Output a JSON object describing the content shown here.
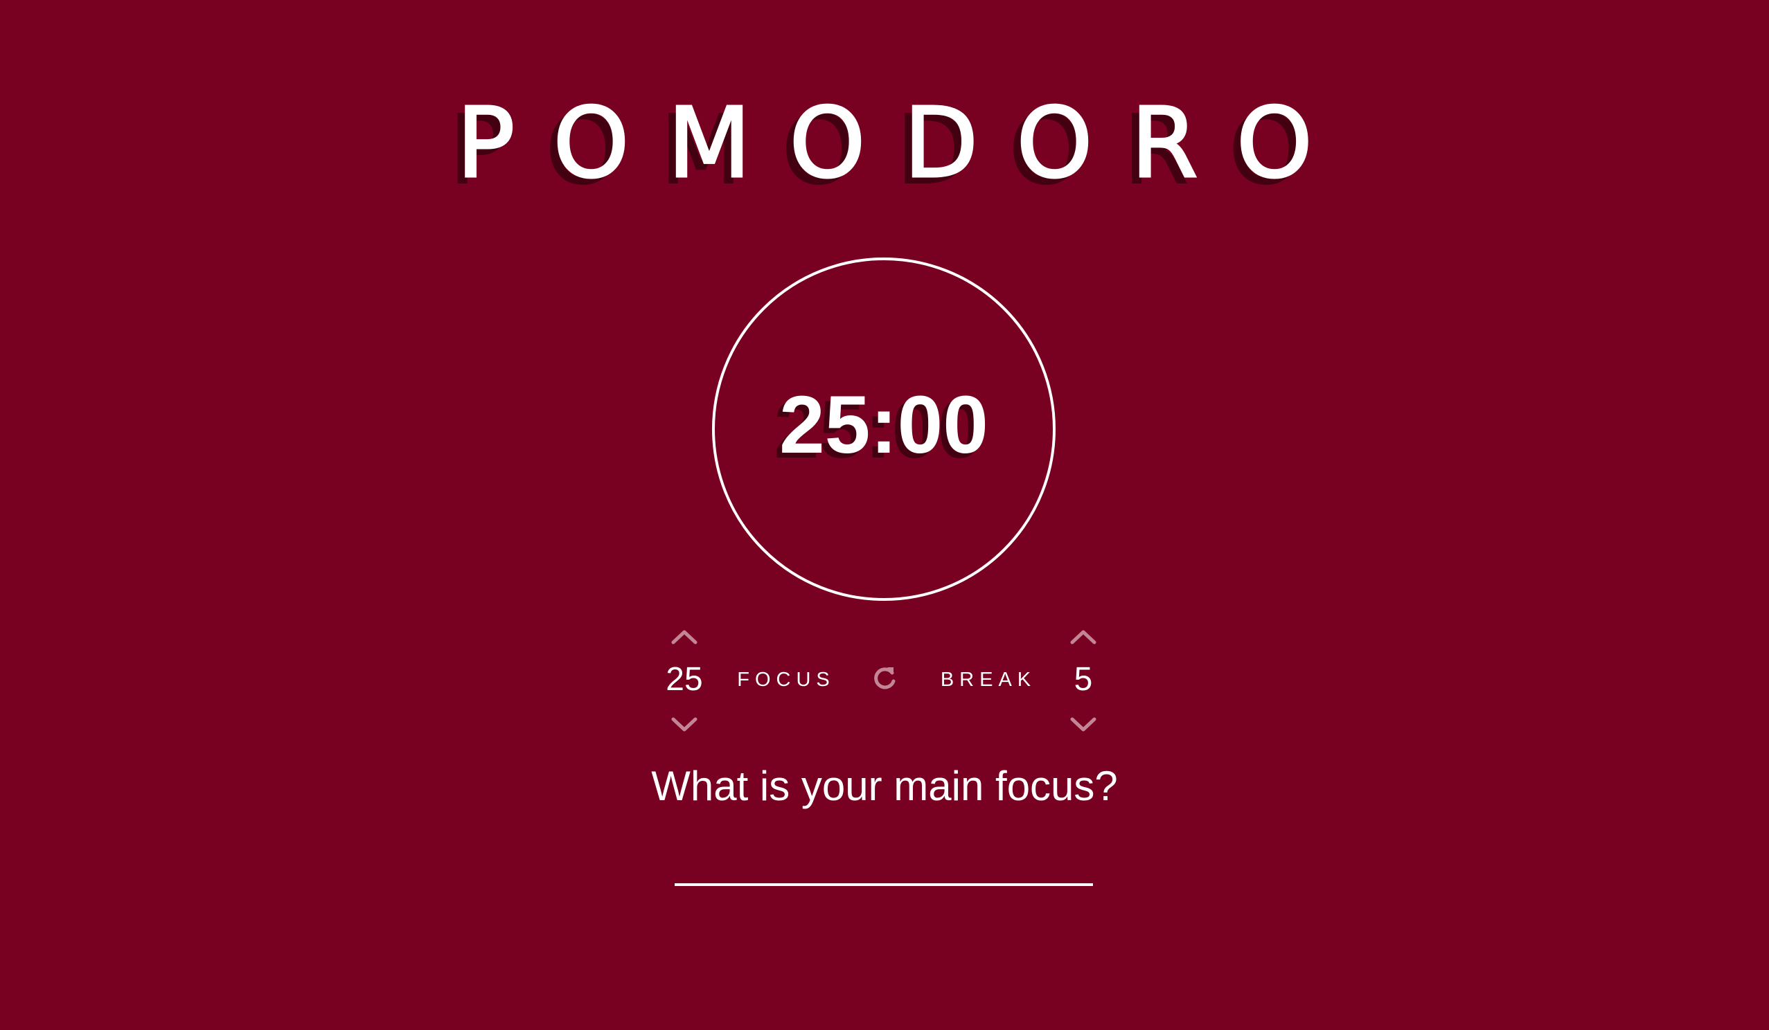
{
  "app": {
    "title": "POMODORO",
    "background_color": "#780020",
    "accent_color": "#ffffff",
    "muted_icon_color": "#c48597"
  },
  "timer": {
    "display": "25:00"
  },
  "focus": {
    "label": "FOCUS",
    "value": "25",
    "increase_icon": "chevron-up-icon",
    "decrease_icon": "chevron-down-icon"
  },
  "break": {
    "label": "BREAK",
    "value": "5",
    "increase_icon": "chevron-up-icon",
    "decrease_icon": "chevron-down-icon"
  },
  "reset": {
    "icon": "refresh-icon"
  },
  "task": {
    "question": "What is your main focus?",
    "value": "",
    "placeholder": ""
  }
}
